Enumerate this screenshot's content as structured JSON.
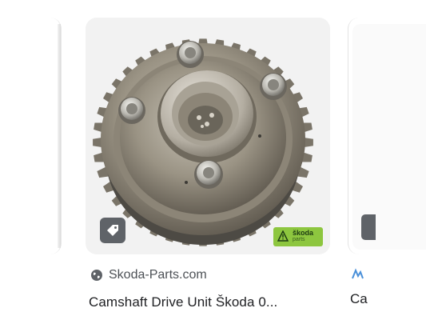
{
  "results": [
    {
      "source": "Skoda-Parts.com",
      "title": "Camshaft Drive Unit Škoda 0...",
      "brand_badge": {
        "line1": "škoda",
        "line2": "parts"
      },
      "icons": {
        "source": "globe-icon",
        "action": "tag-icon",
        "badge": "warning-icon"
      }
    },
    {
      "title": "Ca",
      "icons": {
        "source": "site-favicon-icon"
      }
    }
  ],
  "colors": {
    "title": "#202124",
    "source": "#4d5156",
    "badge": "#8dc63f",
    "action_button": "#5f6368"
  }
}
